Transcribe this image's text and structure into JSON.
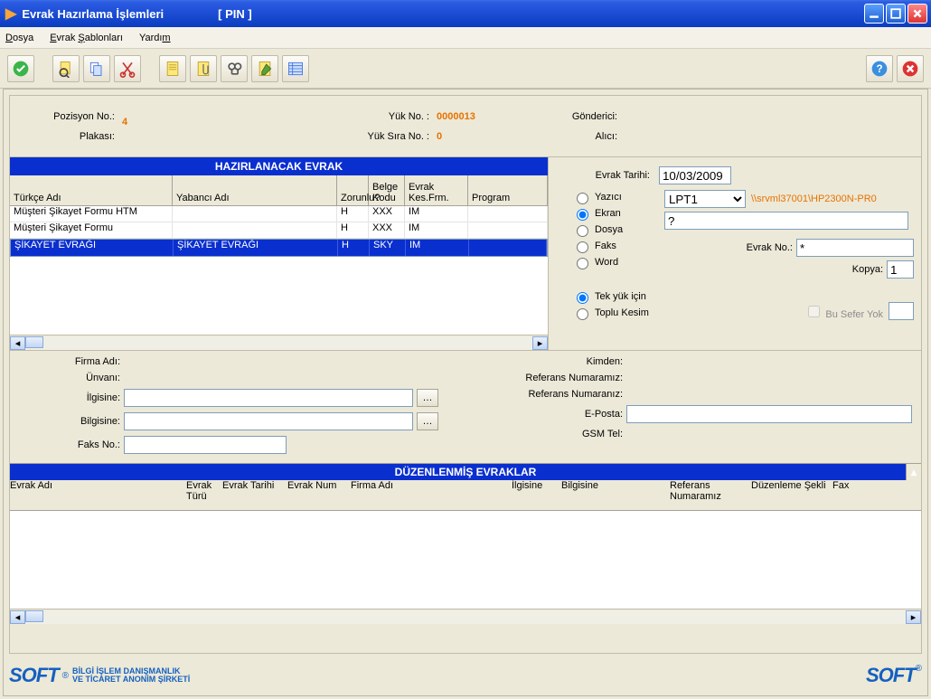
{
  "title": "Evrak Hazırlama İşlemleri",
  "title_extra": "[ PIN ]",
  "menu": {
    "dosya": "Dosya",
    "evrak_sablonlari": "Evrak Şablonları",
    "yardim": "Yardım"
  },
  "info": {
    "pozisyon_no_label": "Pozisyon No.:",
    "pozisyon_no": "4",
    "plakasi_label": "Plakası:",
    "yuk_no_label": "Yük No. :",
    "yuk_no": "0000013",
    "yuk_sira_no_label": "Yük Sıra No. :",
    "yuk_sira_no": "0",
    "gonderici_label": "Gönderici:",
    "alici_label": "Alıcı:"
  },
  "grid1": {
    "title": "HAZIRLANACAK EVRAK",
    "headers": {
      "turkce": "Türkçe Adı",
      "yabanci": "Yabancı Adı",
      "zorunlu": "Zorunlu?",
      "belge_kodu": "Belge Kodu",
      "evrak_kesfrm": "Evrak Kes.Frm.",
      "program": "Program"
    },
    "rows": [
      {
        "turkce": "Müşteri Şikayet Formu HTM",
        "yabanci": "",
        "zorunlu": "H",
        "belge_kodu": "XXX",
        "evrak_kesfrm": "IM",
        "program": ""
      },
      {
        "turkce": "Müşteri Şikayet Formu",
        "yabanci": "",
        "zorunlu": "H",
        "belge_kodu": "XXX",
        "evrak_kesfrm": "IM",
        "program": ""
      },
      {
        "turkce": "ŞİKAYET EVRAĞI",
        "yabanci": "ŞİKAYET EVRAĞI",
        "zorunlu": "H",
        "belge_kodu": "SKY",
        "evrak_kesfrm": "IM",
        "program": ""
      }
    ]
  },
  "options": {
    "evrak_tarihi_label": "Evrak Tarihi:",
    "evrak_tarihi": "10/03/2009",
    "radio1": {
      "yazici": "Yazıcı",
      "ekran": "Ekran",
      "dosya": "Dosya",
      "faks": "Faks",
      "word": "Word"
    },
    "printer_select": "LPT1",
    "printer_path": "\\\\srvml37001\\HP2300N-PR0",
    "ekran_value": "?",
    "evrak_no_label": "Evrak No.:",
    "evrak_no": "*",
    "kopya_label": "Kopya:",
    "kopya": "1",
    "radio2": {
      "tek": "Tek yük için",
      "toplu": "Toplu Kesim"
    },
    "bu_sefer_yok": "Bu Sefer Yok"
  },
  "form": {
    "firma_adi": "Firma Adı:",
    "unvani": "Ünvanı:",
    "ilgisine": "İlgisine:",
    "bilgisine": "Bilgisine:",
    "faks_no": "Faks No.:",
    "kimden": "Kimden:",
    "ref_numaramiz": "Referans Numaramız:",
    "ref_numaraniz": "Referans Numaranız:",
    "eposta": "E-Posta:",
    "gsm_tel": "GSM Tel:"
  },
  "grid2": {
    "title": "DÜZENLENMİŞ EVRAKLAR",
    "headers": {
      "evrak_adi": "Evrak Adı",
      "evrak_turu": "Evrak Türü",
      "evrak_tarihi": "Evrak Tarihi",
      "evrak_num": "Evrak Num",
      "firma_adi": "Firma Adı",
      "ilgisine": "İlgisine",
      "bilgisine": "Bilgisine",
      "ref_no": "Referans Numaramız",
      "duzenleme": "Düzenleme Şekli",
      "fax": "Fax"
    }
  },
  "footer": {
    "tag1": "BİLGİ İŞLEM DANIŞMANLIK",
    "tag2": "VE TİCARET ANONİM ŞİRKETİ",
    "reg": "®"
  }
}
